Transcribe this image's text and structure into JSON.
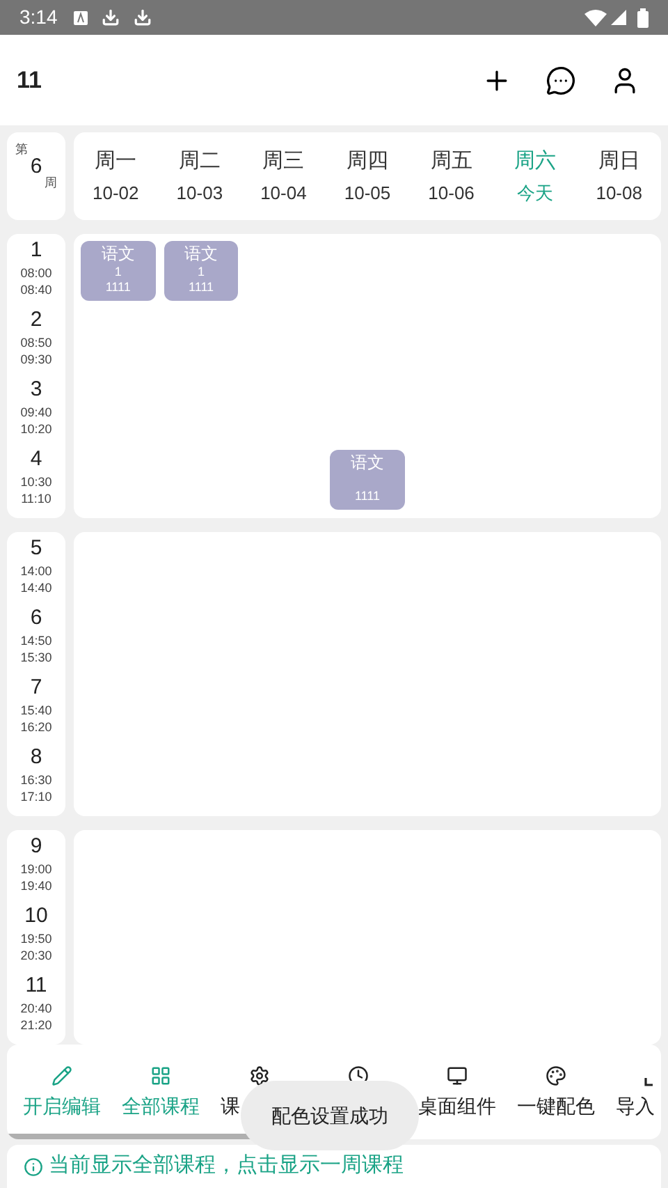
{
  "status_bar": {
    "time": "3:14"
  },
  "header": {
    "title": "11"
  },
  "week": {
    "prefix": "第",
    "number": "6",
    "suffix": "周"
  },
  "days": [
    {
      "name": "周一",
      "date": "10-02",
      "selected": false
    },
    {
      "name": "周二",
      "date": "10-03",
      "selected": false
    },
    {
      "name": "周三",
      "date": "10-04",
      "selected": false
    },
    {
      "name": "周四",
      "date": "10-05",
      "selected": false
    },
    {
      "name": "周五",
      "date": "10-06",
      "selected": false
    },
    {
      "name": "周六",
      "date": "今天",
      "selected": true
    },
    {
      "name": "周日",
      "date": "10-08",
      "selected": false
    }
  ],
  "sections": [
    {
      "slots": [
        {
          "number": "1",
          "start": "08:00",
          "end": "08:40",
          "cells": [
            {
              "kind": "course",
              "name": "语文",
              "room": "1",
              "teacher": "1111",
              "color": "#a9a8c9"
            },
            {
              "kind": "course",
              "name": "语文",
              "room": "1",
              "teacher": "1111",
              "color": "#a9a8c9"
            },
            {
              "kind": "empty"
            },
            {
              "kind": "empty"
            },
            {
              "kind": "empty"
            },
            {
              "kind": "empty"
            },
            {
              "kind": "empty"
            }
          ]
        },
        {
          "number": "2",
          "start": "08:50",
          "end": "09:30"
        },
        {
          "number": "3",
          "start": "09:40",
          "end": "10:20"
        },
        {
          "number": "4",
          "start": "10:30",
          "end": "11:10",
          "cells": [
            {
              "kind": "empty"
            },
            {
              "kind": "empty"
            },
            {
              "kind": "empty"
            },
            {
              "kind": "course",
              "name": "语文",
              "teacher": "1111",
              "color": "#a9a8c9"
            },
            {
              "kind": "empty"
            },
            {
              "kind": "empty"
            },
            {
              "kind": "empty"
            }
          ]
        }
      ]
    },
    {
      "slots": [
        {
          "number": "5",
          "start": "14:00",
          "end": "14:40"
        },
        {
          "number": "6",
          "start": "14:50",
          "end": "15:30"
        },
        {
          "number": "7",
          "start": "15:40",
          "end": "16:20"
        },
        {
          "number": "8",
          "start": "16:30",
          "end": "17:10"
        }
      ]
    },
    {
      "slots": [
        {
          "number": "9",
          "start": "19:00",
          "end": "19:40"
        },
        {
          "number": "10",
          "start": "19:50",
          "end": "20:30"
        },
        {
          "number": "11",
          "start": "20:40",
          "end": "21:20"
        }
      ]
    }
  ],
  "toolbar": [
    {
      "kind": "pencil",
      "label": "开启编辑",
      "selected": true
    },
    {
      "kind": "grid",
      "label": "全部课程",
      "selected": true
    },
    {
      "kind": "gear",
      "label": "课",
      "selected": false
    },
    {
      "kind": "clock",
      "selected": false
    },
    {
      "kind": "monitor",
      "label": "桌面组件",
      "selected": false
    },
    {
      "kind": "palette",
      "label": "一键配色",
      "selected": false
    },
    {
      "kind": "import",
      "label": "导入",
      "selected": false
    }
  ],
  "toast": "配色设置成功",
  "info": "当前显示全部课程，点击显示一周课程"
}
